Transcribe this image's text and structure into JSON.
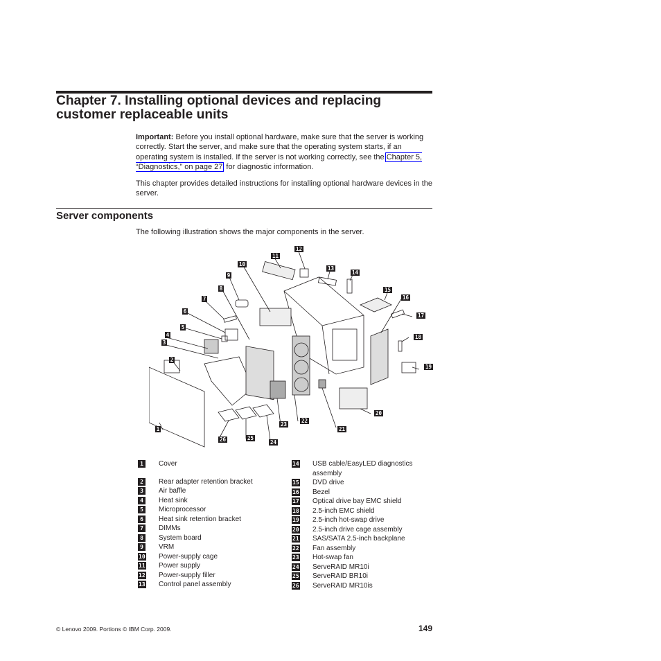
{
  "chapter": {
    "title": "Chapter 7. Installing optional devices and replacing customer replaceable units"
  },
  "important": {
    "label": "Important:",
    "text_before_link": " Before you install optional hardware, make sure that the server is working correctly. Start the server, and make sure that the operating system starts, if an operating system is installed. If the server is not working correctly, see the ",
    "link_text": "Chapter 5, “Diagnostics,” on page 27",
    "text_after_link": " for diagnostic information."
  },
  "paragraph2": "This chapter provides detailed instructions for installing optional hardware devices in the server.",
  "section": {
    "title": "Server components",
    "intro": "The following illustration shows the major components in the server."
  },
  "illustration": {
    "callouts": [
      "1",
      "2",
      "3",
      "4",
      "5",
      "6",
      "7",
      "8",
      "9",
      "10",
      "11",
      "12",
      "13",
      "14",
      "15",
      "16",
      "17",
      "18",
      "19",
      "20",
      "21",
      "22",
      "23",
      "24",
      "25",
      "26"
    ]
  },
  "legend": {
    "left": [
      {
        "num": "1",
        "label": "Cover"
      },
      {
        "num": "2",
        "label": "Rear adapter retention bracket"
      },
      {
        "num": "3",
        "label": "Air baffle"
      },
      {
        "num": "4",
        "label": "Heat sink"
      },
      {
        "num": "5",
        "label": "Microprocessor"
      },
      {
        "num": "6",
        "label": "Heat sink retention bracket"
      },
      {
        "num": "7",
        "label": "DIMMs"
      },
      {
        "num": "8",
        "label": "System board"
      },
      {
        "num": "9",
        "label": "VRM"
      },
      {
        "num": "10",
        "label": "Power-supply cage"
      },
      {
        "num": "11",
        "label": "Power supply"
      },
      {
        "num": "12",
        "label": "Power-supply filler"
      },
      {
        "num": "13",
        "label": "Control panel assembly"
      }
    ],
    "right": [
      {
        "num": "14",
        "label": "USB cable/EasyLED diagnostics assembly"
      },
      {
        "num": "15",
        "label": "DVD drive"
      },
      {
        "num": "16",
        "label": "Bezel"
      },
      {
        "num": "17",
        "label": "Optical drive bay EMC shield"
      },
      {
        "num": "18",
        "label": "2.5-inch EMC shield"
      },
      {
        "num": "19",
        "label": "2.5-inch hot-swap drive"
      },
      {
        "num": "20",
        "label": "2.5-inch drive cage assembly"
      },
      {
        "num": "21",
        "label": "SAS/SATA 2.5-inch backplane"
      },
      {
        "num": "22",
        "label": "Fan assembly"
      },
      {
        "num": "23",
        "label": "Hot-swap fan"
      },
      {
        "num": "24",
        "label": "ServeRAID MR10i"
      },
      {
        "num": "25",
        "label": "ServeRAID BR10i"
      },
      {
        "num": "26",
        "label": "ServeRAID MR10is"
      }
    ]
  },
  "footer": {
    "copyright": "© Lenovo 2009. Portions © IBM Corp. 2009.",
    "page_number": "149"
  }
}
